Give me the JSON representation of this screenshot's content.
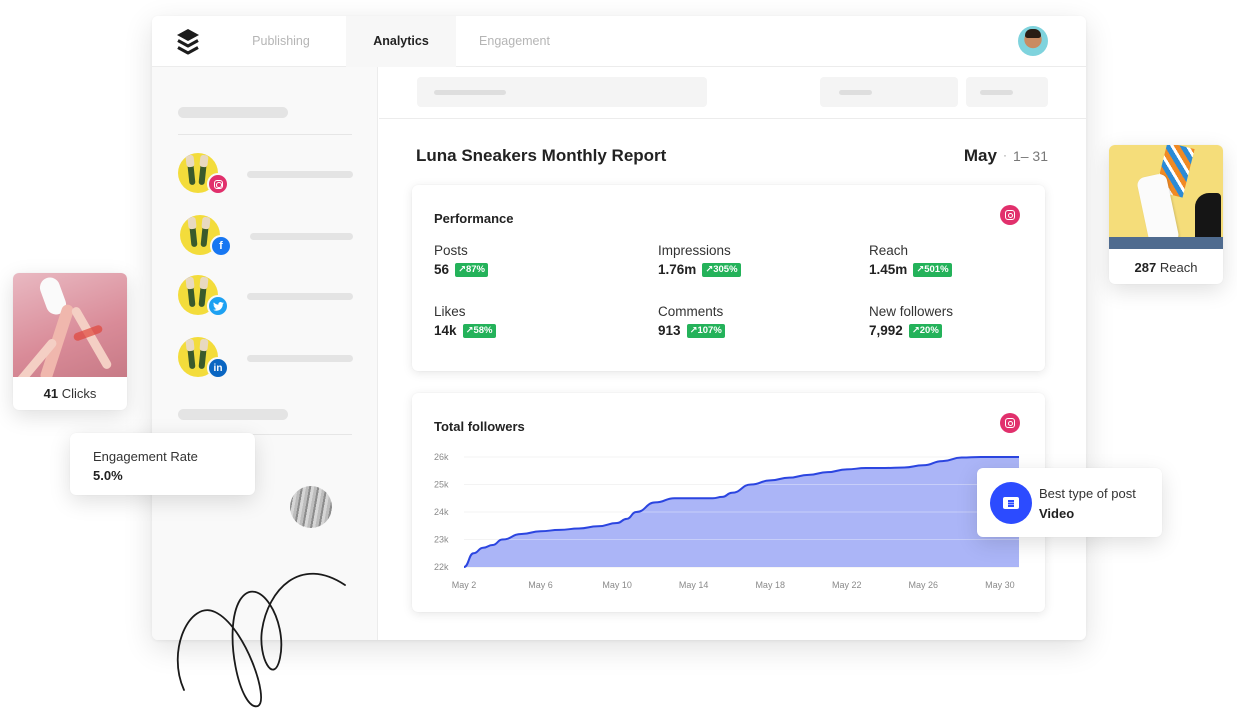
{
  "nav": {
    "logo": "buffer-stack-logo",
    "tabs": [
      {
        "label": "Publishing",
        "active": false
      },
      {
        "label": "Analytics",
        "active": true
      },
      {
        "label": "Engagement",
        "active": false
      }
    ],
    "user_avatar": "user-avatar"
  },
  "sidebar": {
    "profiles": [
      {
        "network": "instagram",
        "icon": "instagram-icon",
        "glyph": "◎",
        "color": "#e1306c"
      },
      {
        "network": "facebook",
        "icon": "facebook-icon",
        "glyph": "f",
        "color": "#1877f2"
      },
      {
        "network": "twitter",
        "icon": "twitter-icon",
        "glyph": "🐦",
        "color": "#1da1f2"
      },
      {
        "network": "linkedin",
        "icon": "linkedin-icon",
        "glyph": "in",
        "color": "#0a66c2"
      }
    ]
  },
  "report": {
    "title": "Luna Sneakers Monthly Report",
    "month": "May",
    "separator": "·",
    "days": "1– 31"
  },
  "performance": {
    "title": "Performance",
    "network_icon": "instagram-icon",
    "metrics": [
      {
        "label": "Posts",
        "value": "56",
        "change": "↗87%"
      },
      {
        "label": "Impressions",
        "value": "1.76m",
        "change": "↗305%"
      },
      {
        "label": "Reach",
        "value": "1.45m",
        "change": "↗501%"
      },
      {
        "label": "Likes",
        "value": "14k",
        "change": "↗58%"
      },
      {
        "label": "Comments",
        "value": "913",
        "change": "↗107%"
      },
      {
        "label": "New followers",
        "value": "7,992",
        "change": "↗20%"
      }
    ],
    "change_color": "#24b25a"
  },
  "chart_data": {
    "type": "area",
    "title": "Total followers",
    "xlabel": "",
    "ylabel": "",
    "x_ticks": [
      "May 2",
      "May 6",
      "May 10",
      "May 14",
      "May 18",
      "May 22",
      "May 26",
      "May 30"
    ],
    "y_ticks": [
      "22k",
      "23k",
      "24k",
      "25k",
      "26k"
    ],
    "ylim": [
      22000,
      26000
    ],
    "xlim": [
      2,
      31
    ],
    "grid": true,
    "series": [
      {
        "name": "Total followers",
        "color": "#2b45e0",
        "fill": "#a6b1f7",
        "x": [
          2,
          2.5,
          3,
          3.5,
          4,
          5,
          6,
          7,
          8,
          9,
          10,
          10.5,
          11,
          12,
          13,
          14,
          15,
          15.5,
          16,
          17,
          18,
          19,
          20,
          21,
          22,
          23,
          24,
          25,
          26,
          27,
          28,
          29,
          30,
          31
        ],
        "y": [
          22000,
          22500,
          22700,
          22800,
          23000,
          23200,
          23300,
          23350,
          23400,
          23480,
          23600,
          23750,
          24000,
          24350,
          24500,
          24500,
          24500,
          24550,
          24700,
          25000,
          25150,
          25250,
          25350,
          25450,
          25550,
          25600,
          25600,
          25620,
          25700,
          25850,
          25980,
          26000,
          26000,
          26000
        ]
      }
    ]
  },
  "cards": {
    "clicks": {
      "value": "41",
      "label": "Clicks"
    },
    "reach": {
      "value": "287",
      "label": "Reach"
    },
    "engagement": {
      "label": "Engagement Rate",
      "value": "5.0%"
    },
    "best_post": {
      "label": "Best type of post",
      "value": "Video",
      "icon": "post-type-icon",
      "color": "#2c4bff"
    }
  }
}
